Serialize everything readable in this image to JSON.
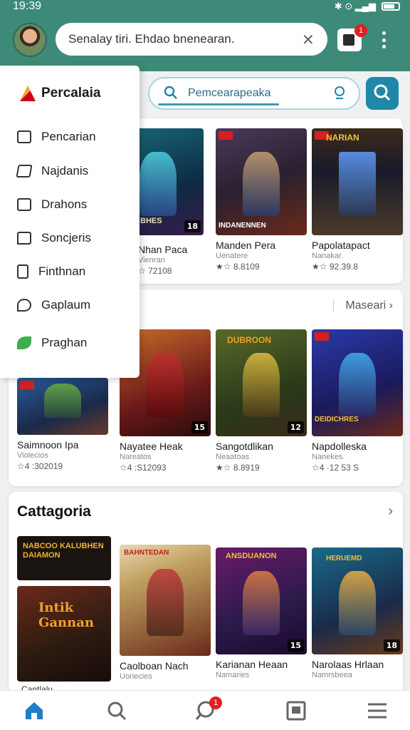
{
  "status_bar": {
    "time": "19:39",
    "icons": "✱ ⊙ ▂▄▆"
  },
  "header": {
    "search_value": "Senalay tiri. Ehdao bnenearan.",
    "notification_count": "1"
  },
  "secondary_search": {
    "value": "Pemcearapeaka"
  },
  "drawer": {
    "brand": "Percalaia",
    "items": [
      {
        "label": "Pencarian",
        "icon": "store-icon"
      },
      {
        "label": "Najdanis",
        "icon": "edit-icon"
      },
      {
        "label": "Drahons",
        "icon": "checkbox-icon"
      },
      {
        "label": "Soncjeris",
        "icon": "chat-icon"
      },
      {
        "label": "Finthnan",
        "icon": "document-icon"
      },
      {
        "label": "Gaplaum",
        "icon": "pin-icon"
      },
      {
        "label": "Praghan",
        "icon": "leaf-icon"
      }
    ]
  },
  "section1": {
    "games": [
      {
        "title": "Nhan Paca",
        "sub": "Vienran",
        "meta": "☆ 72108",
        "rating": "18"
      },
      {
        "title": "Manden Pera",
        "sub": "Uenatere",
        "meta": "★☆ 8.8109",
        "rating": ""
      },
      {
        "title": "Papolatapact",
        "sub": "Nanakar.",
        "meta": "★☆ 92.39.8",
        "rating": ""
      }
    ],
    "cover_texts": [
      "JUHN BHES",
      "INDANENNEN",
      "NARIAN"
    ]
  },
  "section2": {
    "more_label": "Maseari",
    "games": [
      {
        "title": "Saimnoon Ipa",
        "sub": "Violecios",
        "meta": "☆4 :302019",
        "rating": ""
      },
      {
        "title": "Nayatee Heak",
        "sub": "Nareatos",
        "meta": "☆4 :S12093",
        "rating": "15"
      },
      {
        "title": "Sangotdlikan",
        "sub": "Neaatoas",
        "meta": "★☆ 8.8919",
        "rating": "12"
      },
      {
        "title": "Napdolleska",
        "sub": "Nanekes.",
        "meta": "☆4 ·12 53 S",
        "rating": ""
      }
    ],
    "cover_texts": [
      "DUBROON",
      "DEIDICHRES"
    ]
  },
  "categories": {
    "title": "Cattagoria",
    "games": [
      {
        "title": "Caolboan Nach",
        "sub": "Uoriecies",
        "rating": ""
      },
      {
        "title": "Karianan Heaan",
        "sub": "Namaries",
        "rating": "15"
      },
      {
        "title": "Narolaas Hrlaan",
        "sub": "Namrsbeea",
        "rating": "18"
      }
    ],
    "cover_texts": [
      "NABCOO KALUBHEN DAIAMON",
      "Intik Gannan",
      "BAHNTEDAN",
      "ANSDUANON",
      "HERUEMD"
    ],
    "partial_caption": "Cantlalu"
  },
  "colors": {
    "header": "#3e8a78",
    "accent": "#1e88a8",
    "badge": "#e02020",
    "nav_active": "#1e7fc4"
  }
}
